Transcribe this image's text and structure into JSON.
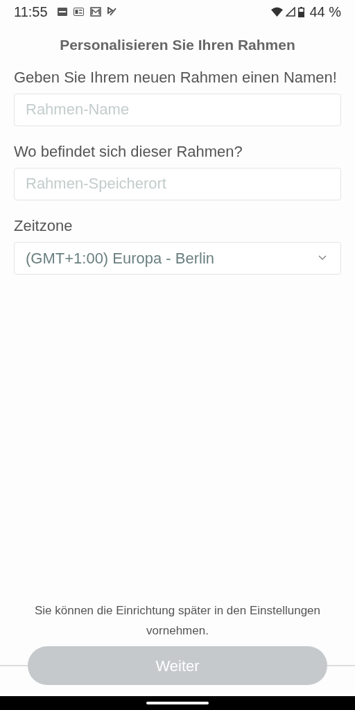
{
  "status_bar": {
    "time": "11:55",
    "battery": "44 %"
  },
  "title": "Personalisieren Sie Ihren Rahmen",
  "fields": [
    {
      "kind": "text",
      "label": "Geben Sie Ihrem neuen Rahmen einen Namen!",
      "placeholder": "Rahmen-Name"
    },
    {
      "kind": "text",
      "label": "Wo befindet sich dieser Rahmen?",
      "placeholder": "Rahmen-Speicherort"
    },
    {
      "kind": "select",
      "label": "Zeitzone",
      "value": "(GMT+1:00) Europa - Berlin"
    }
  ],
  "note": "Sie können die Einrichtung später in den Einstellungen vornehmen.",
  "button": {
    "label": "Weiter",
    "disabled": true
  }
}
